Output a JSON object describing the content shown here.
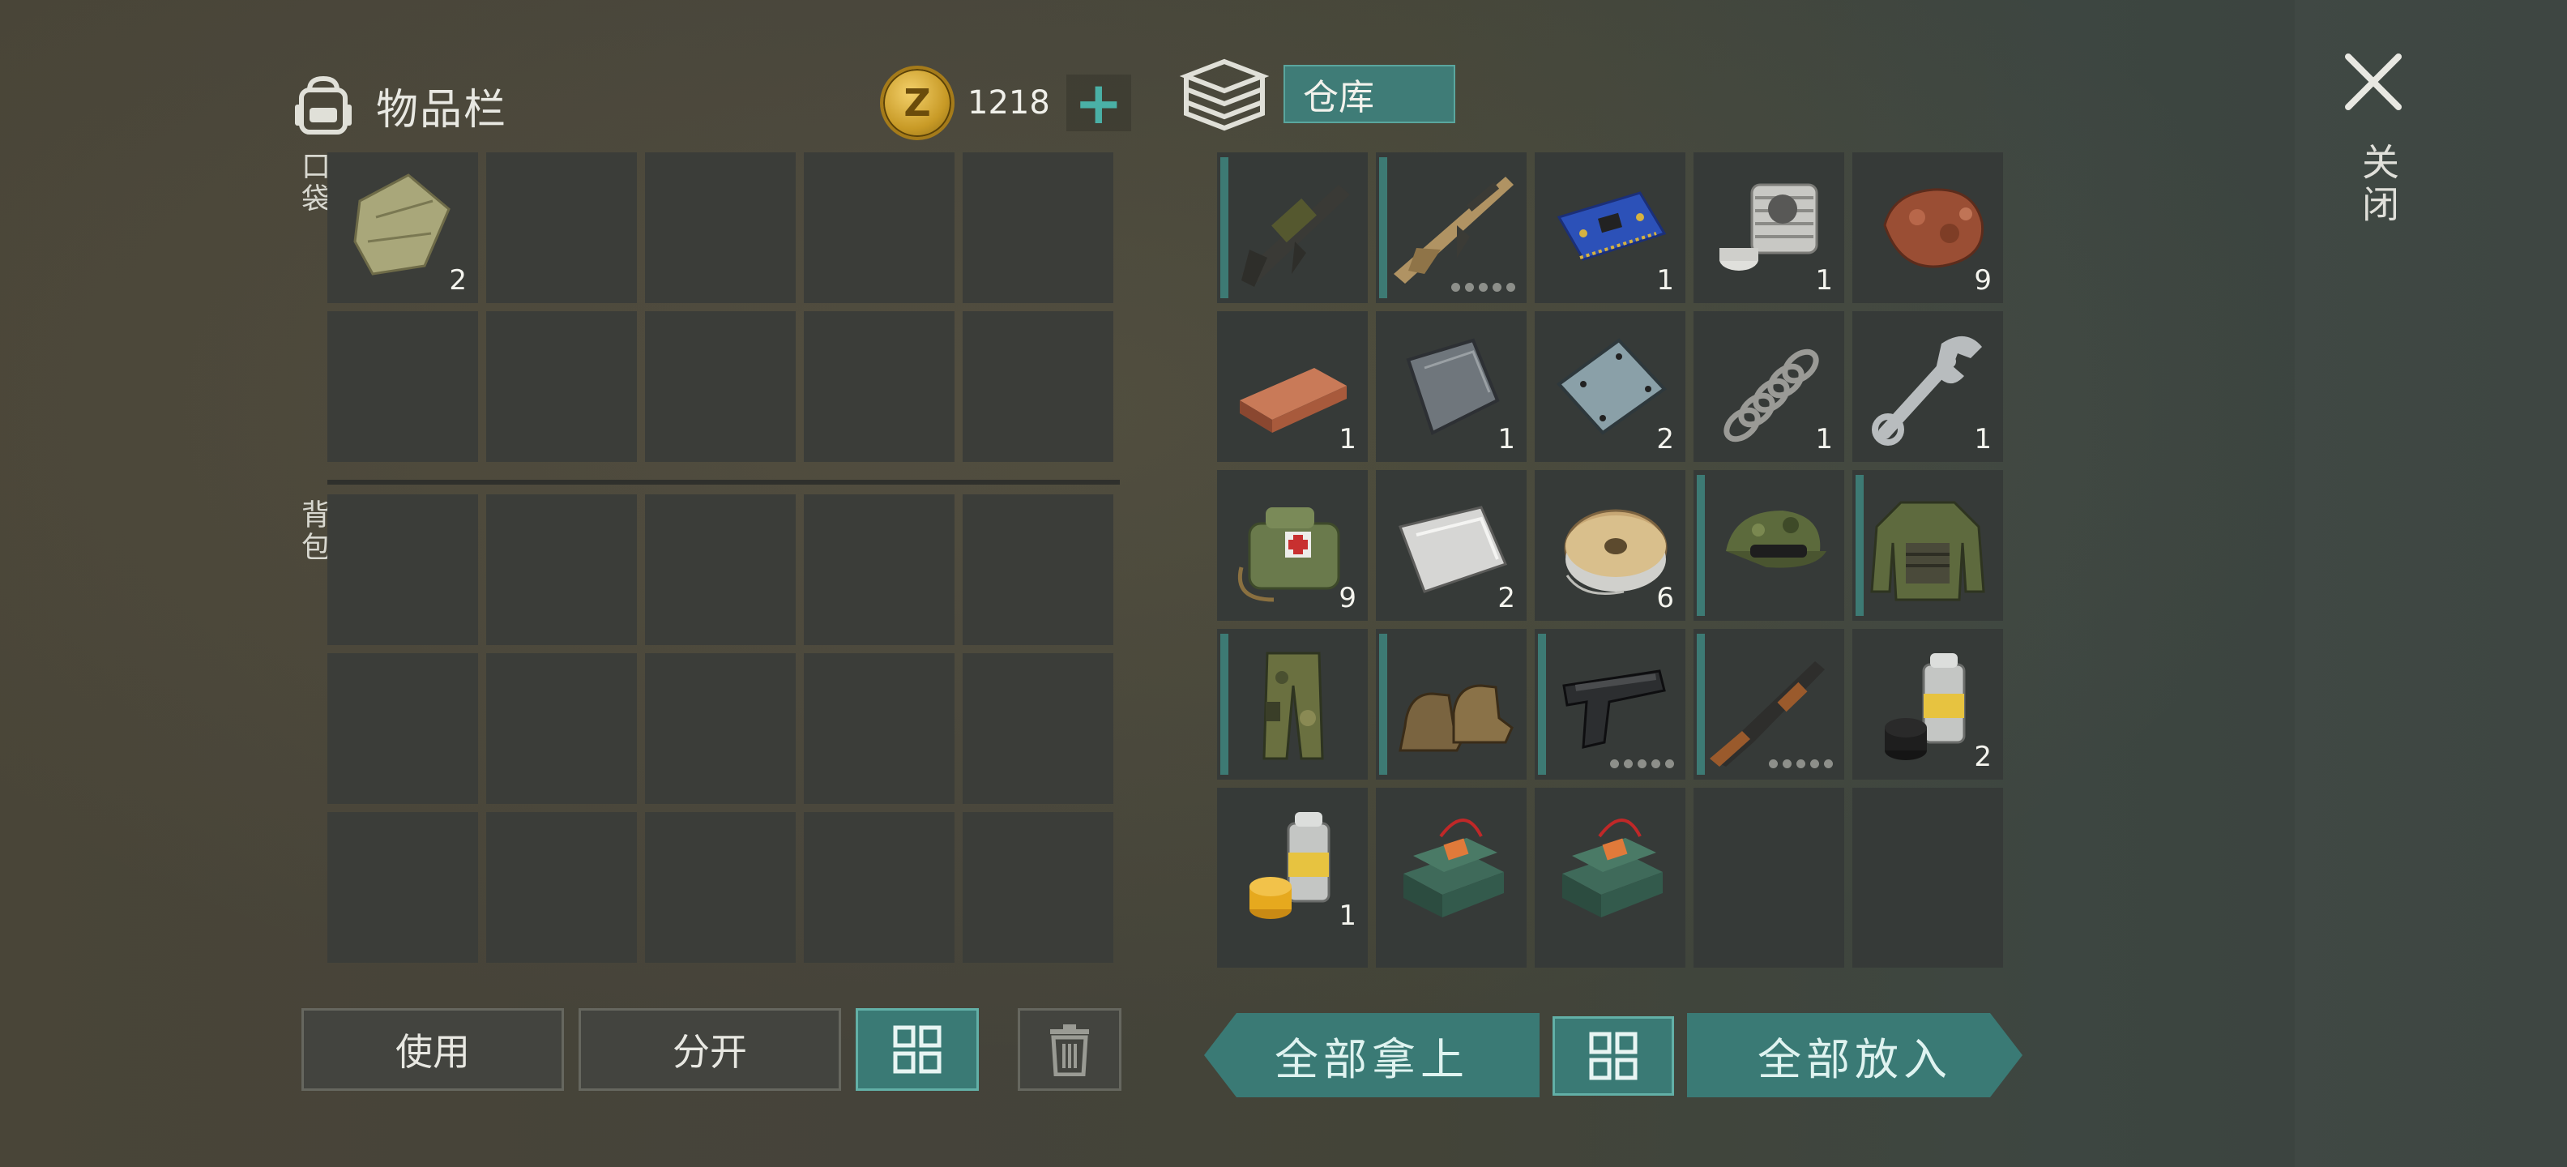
{
  "inventory": {
    "title": "物品栏",
    "pocket_label": "口袋",
    "backpack_label": "背包",
    "pocket_items": [
      {
        "icon": "cloth-rag-icon",
        "qty": "2"
      }
    ]
  },
  "currency": {
    "amount": "1218",
    "coin_symbol": "Z",
    "add_symbol": "+"
  },
  "warehouse": {
    "title": "仓库",
    "items": [
      {
        "icon": "grenade-launcher-rifle-icon",
        "qty": "",
        "bar": true,
        "dots": false
      },
      {
        "icon": "assault-rifle-icon",
        "qty": "",
        "bar": true,
        "dots": true
      },
      {
        "icon": "circuit-board-icon",
        "qty": "1"
      },
      {
        "icon": "engine-cylinder-icon",
        "qty": "1"
      },
      {
        "icon": "copper-ore-icon",
        "qty": "9"
      },
      {
        "icon": "copper-ingot-icon",
        "qty": "1"
      },
      {
        "icon": "iron-plate-icon",
        "qty": "1"
      },
      {
        "icon": "steel-plate-icon",
        "qty": "2"
      },
      {
        "icon": "spring-icon",
        "qty": "1"
      },
      {
        "icon": "wrench-icon",
        "qty": "1"
      },
      {
        "icon": "medkit-bag-icon",
        "qty": "9"
      },
      {
        "icon": "aluminum-sheet-icon",
        "qty": "2"
      },
      {
        "icon": "wire-spool-icon",
        "qty": "6"
      },
      {
        "icon": "camo-cap-icon",
        "qty": "",
        "bar": true
      },
      {
        "icon": "tactical-jacket-icon",
        "qty": "",
        "bar": true
      },
      {
        "icon": "camo-pants-icon",
        "qty": "",
        "bar": true
      },
      {
        "icon": "boots-icon",
        "qty": "",
        "bar": true
      },
      {
        "icon": "pistol-icon",
        "qty": "",
        "bar": true,
        "dots": true
      },
      {
        "icon": "shotgun-icon",
        "qty": "",
        "bar": true,
        "dots": true
      },
      {
        "icon": "black-paint-can-icon",
        "qty": "2"
      },
      {
        "icon": "yellow-paint-can-icon",
        "qty": "1"
      },
      {
        "icon": "c4-explosive-icon",
        "qty": ""
      },
      {
        "icon": "c4-explosive-icon",
        "qty": ""
      },
      {
        "icon": "",
        "qty": ""
      },
      {
        "icon": "",
        "qty": ""
      }
    ]
  },
  "buttons": {
    "use": "使用",
    "split": "分开",
    "take_all": "全部拿上",
    "put_all": "全部放入"
  },
  "close_label": "关闭",
  "colors": {
    "accent_teal": "#3a7a75",
    "coin_gold": "#d6a838",
    "cell_bg": "#3b3d39"
  }
}
